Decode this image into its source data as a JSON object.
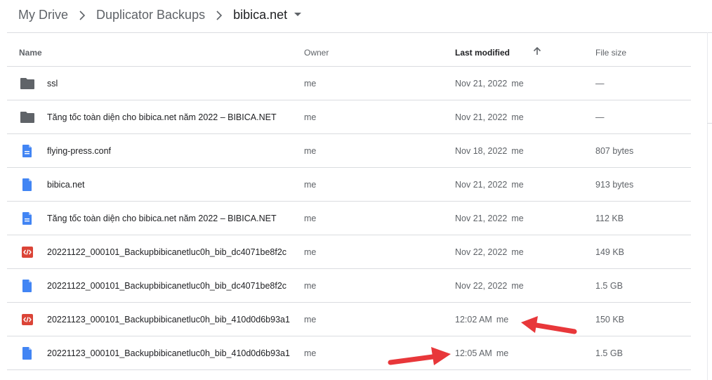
{
  "breadcrumb": {
    "items": [
      "My Drive",
      "Duplicator Backups",
      "bibica.net"
    ]
  },
  "table": {
    "headers": {
      "name": "Name",
      "owner": "Owner",
      "modified": "Last modified",
      "size": "File size"
    },
    "sort_icon": "arrow-up-icon",
    "rows": [
      {
        "icon": "folder-icon",
        "name": "ssl",
        "owner": "me",
        "modified": "Nov 21, 2022",
        "modified_by": "me",
        "size": "—"
      },
      {
        "icon": "folder-icon",
        "name": "Tăng tốc toàn diện cho bibica.net năm 2022 – BIBICA.NET",
        "owner": "me",
        "modified": "Nov 21, 2022",
        "modified_by": "me",
        "size": "—"
      },
      {
        "icon": "document-icon",
        "name": "flying-press.conf",
        "owner": "me",
        "modified": "Nov 18, 2022",
        "modified_by": "me",
        "size": "807 bytes"
      },
      {
        "icon": "file-icon",
        "name": "bibica.net",
        "owner": "me",
        "modified": "Nov 21, 2022",
        "modified_by": "me",
        "size": "913 bytes"
      },
      {
        "icon": "document-icon",
        "name": "Tăng tốc toàn diện cho bibica.net năm 2022 – BIBICA.NET",
        "owner": "me",
        "modified": "Nov 21, 2022",
        "modified_by": "me",
        "size": "112 KB"
      },
      {
        "icon": "code-file-icon",
        "name": "20221122_000101_Backupbibicanetluc0h_bib_dc4071be8f2c",
        "owner": "me",
        "modified": "Nov 22, 2022",
        "modified_by": "me",
        "size": "149 KB"
      },
      {
        "icon": "file-icon",
        "name": "20221122_000101_Backupbibicanetluc0h_bib_dc4071be8f2c",
        "owner": "me",
        "modified": "Nov 22, 2022",
        "modified_by": "me",
        "size": "1.5 GB"
      },
      {
        "icon": "code-file-icon",
        "name": "20221123_000101_Backupbibicanetluc0h_bib_410d0d6b93a1",
        "owner": "me",
        "modified": "12:02 AM",
        "modified_by": "me",
        "size": "150 KB"
      },
      {
        "icon": "file-icon",
        "name": "20221123_000101_Backupbibicanetluc0h_bib_410d0d6b93a1",
        "owner": "me",
        "modified": "12:05 AM",
        "modified_by": "me",
        "size": "1.5 GB"
      }
    ]
  },
  "annotations": {
    "arrow_color": "#e8373a"
  },
  "colors": {
    "folder": "#5f6368",
    "document": "#4285f4",
    "code": "#db4437"
  }
}
